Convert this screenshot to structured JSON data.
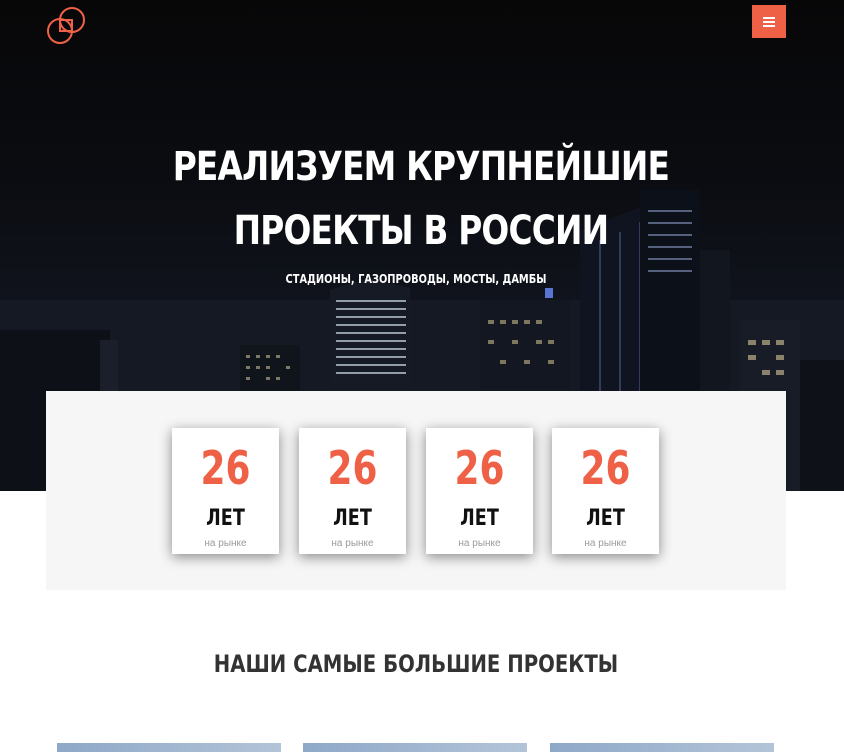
{
  "header": {
    "logo_icon": "interlocked-squares-logo-icon",
    "menu_icon": "hamburger-menu-icon",
    "accent_color": "#ef6146"
  },
  "hero": {
    "title_line1": "РЕАЛИЗУЕМ КРУПНЕЙШИЕ",
    "title_line2": "ПРОЕКТЫ В РОССИИ",
    "subtitle": "СТАДИОНЫ, ГАЗОПРОВОДЫ, МОСТЫ, ДАМБЫ"
  },
  "stats": [
    {
      "number": "26",
      "unit": "ЛЕТ",
      "caption": "на рынке"
    },
    {
      "number": "26",
      "unit": "ЛЕТ",
      "caption": "на рынке"
    },
    {
      "number": "26",
      "unit": "ЛЕТ",
      "caption": "на рынке"
    },
    {
      "number": "26",
      "unit": "ЛЕТ",
      "caption": "на рынке"
    }
  ],
  "projects": {
    "title": "НАШИ САМЫЕ БОЛЬШИЕ ПРОЕКТЫ"
  }
}
